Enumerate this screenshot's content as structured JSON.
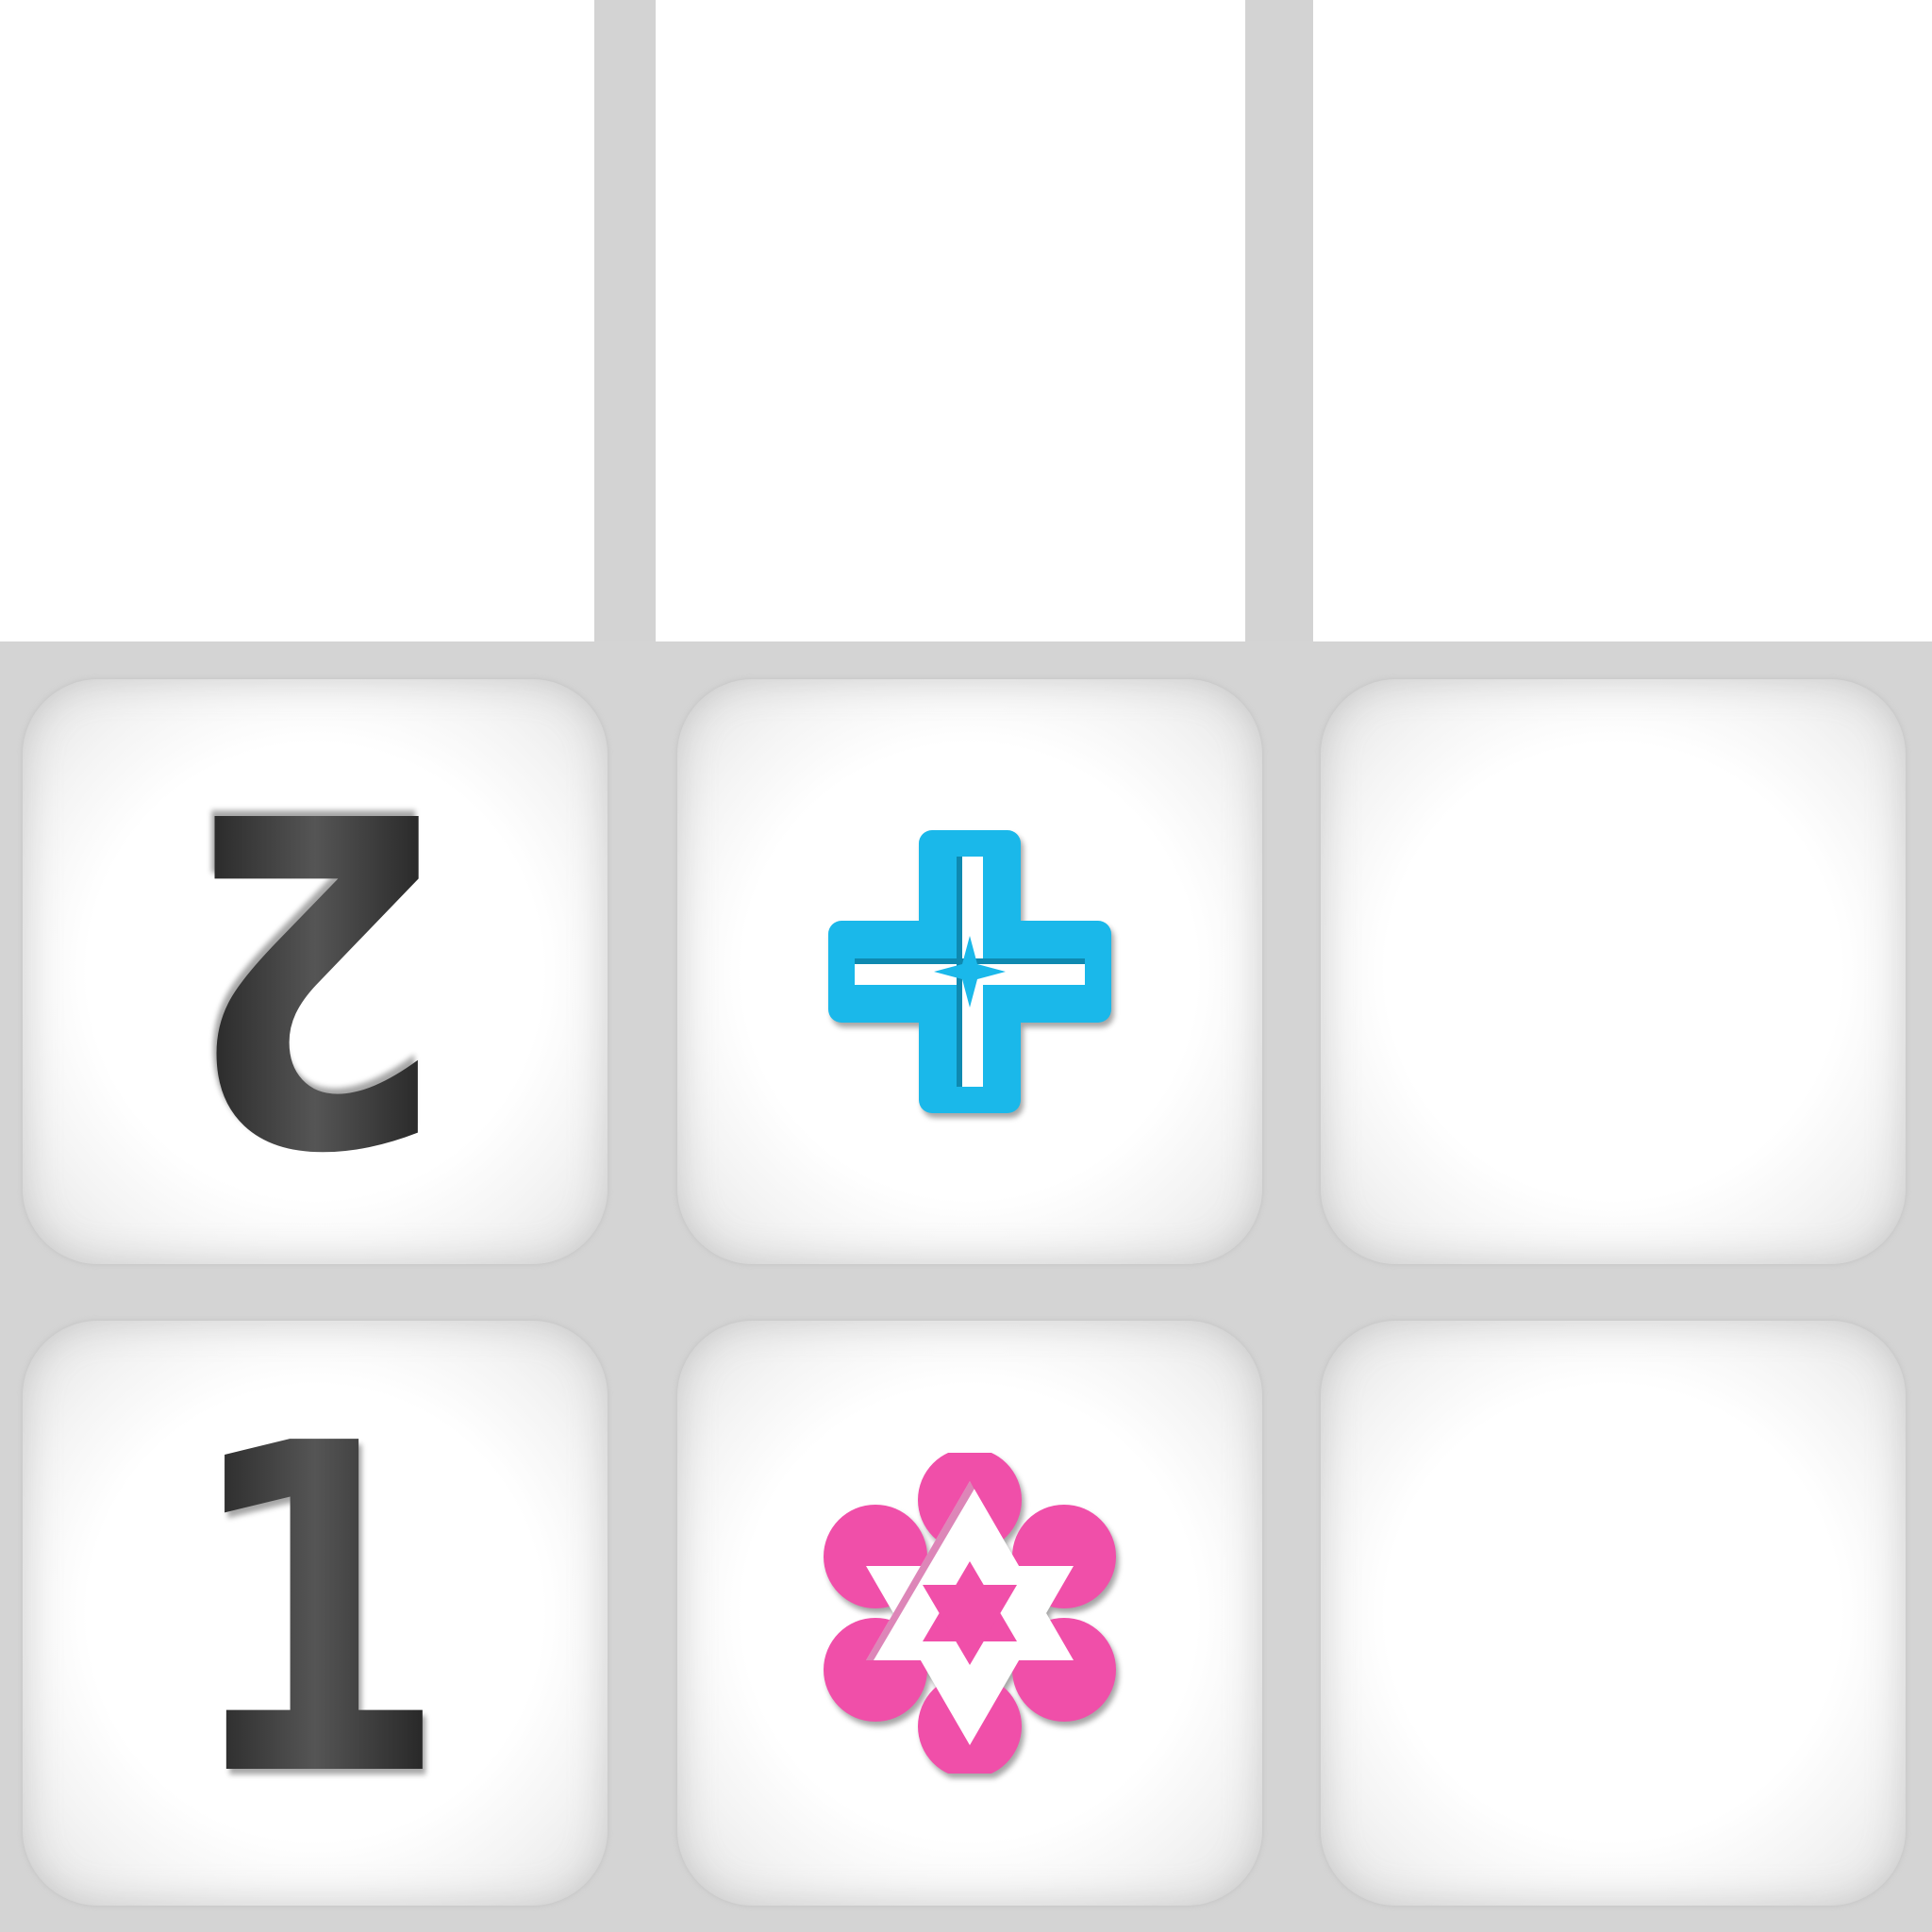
{
  "tiles": [
    {
      "row": 0,
      "col": 0,
      "kind": "number",
      "value": "2",
      "orientation": "upside-down"
    },
    {
      "row": 0,
      "col": 1,
      "kind": "symbol",
      "icon": "cross-plus-icon",
      "color": "#1ab8ea"
    },
    {
      "row": 0,
      "col": 2,
      "kind": "empty"
    },
    {
      "row": 1,
      "col": 0,
      "kind": "number",
      "value": "1",
      "orientation": "upright"
    },
    {
      "row": 1,
      "col": 1,
      "kind": "symbol",
      "icon": "flower-star-icon",
      "color": "#f04fa9"
    },
    {
      "row": 1,
      "col": 2,
      "kind": "empty"
    }
  ],
  "colors": {
    "grid": "#d4d4d4",
    "tile": "#ffffff",
    "number": "#2f2f2f",
    "cyan": "#1ab8ea",
    "pink": "#f04fa9"
  }
}
